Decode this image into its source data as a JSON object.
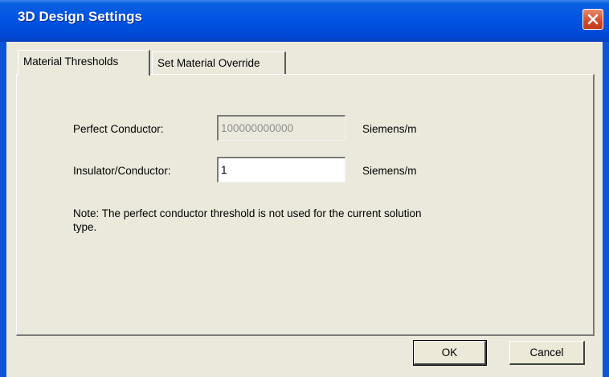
{
  "window": {
    "title": "3D Design Settings"
  },
  "tabs": [
    {
      "label": "Material Thresholds",
      "active": true
    },
    {
      "label": "Set Material Override",
      "active": false
    }
  ],
  "fields": {
    "perfect_conductor": {
      "label": "Perfect Conductor:",
      "value": "100000000000",
      "unit": "Siemens/m",
      "disabled": true
    },
    "insulator_conductor": {
      "label": "Insulator/Conductor:",
      "value": "1",
      "unit": "Siemens/m",
      "disabled": false
    }
  },
  "note": "Note: The perfect conductor threshold is not used for the current solution type.",
  "buttons": {
    "ok": "OK",
    "cancel": "Cancel"
  },
  "colors": {
    "titlebar": "#0054e3",
    "dialog_bg": "#ebe9dc",
    "close_button": "#d2492a"
  }
}
